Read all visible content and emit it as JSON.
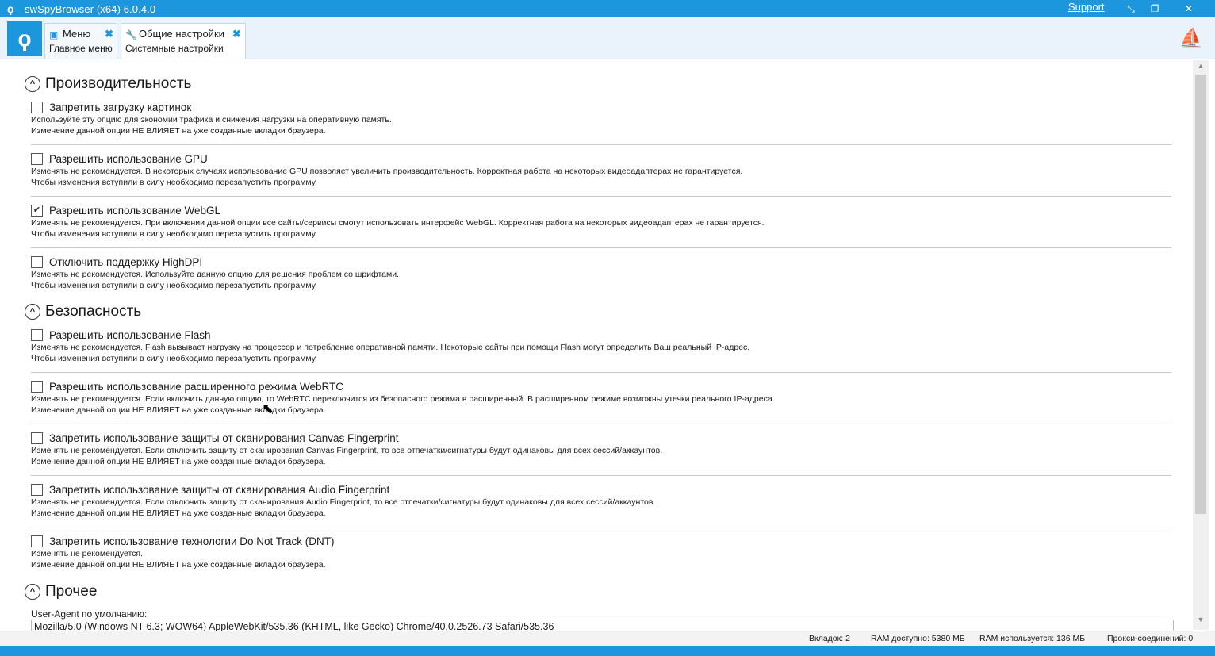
{
  "window": {
    "title": "swSpyBrowser (x64) 6.0.4.0",
    "support_link": "Support",
    "icons": [
      "app-logo-icon",
      "restore-icon",
      "maximize-icon",
      "close-icon"
    ]
  },
  "tabs": [
    {
      "title": "Меню",
      "subtitle": "Главное меню",
      "icon": "menu-icon",
      "active": false
    },
    {
      "title": "Общие настройки",
      "subtitle": "Системные настройки",
      "icon": "wrench-icon",
      "active": true
    }
  ],
  "sections": {
    "performance": {
      "title": "Производительность",
      "options": [
        {
          "label": "Запретить загрузку картинок",
          "checked": false,
          "desc1": "Используйте эту опцию для экономии трафика и снижения нагрузки на оперативную память.",
          "desc2": "Изменение данной опции НЕ ВЛИЯЕТ на уже созданные вкладки браузера."
        },
        {
          "label": "Разрешить использование GPU",
          "checked": false,
          "desc1": "Изменять не рекомендуется. В некоторых случаях использование GPU позволяет увеличить производительность. Корректная работа на некоторых видеоадаптерах не гарантируется.",
          "desc2": "Чтобы изменения вступили в силу необходимо перезапустить программу."
        },
        {
          "label": "Разрешить использование WebGL",
          "checked": true,
          "desc1": "Изменять не рекомендуется. При включении данной опции все сайты/сервисы смогут использовать интерфейс WebGL. Корректная работа на некоторых видеоадаптерах не гарантируется.",
          "desc2": "Чтобы изменения вступили в силу необходимо перезапустить программу."
        },
        {
          "label": "Отключить поддержку HighDPI",
          "checked": false,
          "desc1": "Изменять не рекомендуется. Используйте данную опцию для решения проблем со шрифтами.",
          "desc2": "Чтобы изменения вступили в силу необходимо перезапустить программу."
        }
      ]
    },
    "security": {
      "title": "Безопасность",
      "options": [
        {
          "label": "Разрешить использование Flash",
          "checked": false,
          "desc1": "Изменять не рекомендуется. Flash вызывает нагрузку на процессор и потребление оперативной памяти. Некоторые сайты при помощи Flash могут определить Ваш реальный IP-адрес.",
          "desc2": "Чтобы изменения вступили в силу необходимо перезапустить программу."
        },
        {
          "label": "Разрешить использование расширенного режима WebRTC",
          "checked": false,
          "desc1": "Изменять не рекомендуется. Если включить данную опцию, то WebRTC переключится из безопасного режима в расширенный. В расширенном режиме возможны утечки реального IP-адреса.",
          "desc2": "Изменение данной опции НЕ ВЛИЯЕТ на уже созданные вкладки браузера."
        },
        {
          "label": "Запретить использование защиты от сканирования Canvas Fingerprint",
          "checked": false,
          "desc1": "Изменять не рекомендуется. Если отключить защиту от сканирования Canvas Fingerprint, то все отпечатки/сигнатуры будут одинаковы для всех сессий/аккаунтов.",
          "desc2": "Изменение данной опции НЕ ВЛИЯЕТ на уже созданные вкладки браузера."
        },
        {
          "label": "Запретить использование защиты от сканирования Audio Fingerprint",
          "checked": false,
          "desc1": "Изменять не рекомендуется. Если отключить защиту от сканирования Audio Fingerprint, то все отпечатки/сигнатуры будут одинаковы для всех сессий/аккаунтов.",
          "desc2": "Изменение данной опции НЕ ВЛИЯЕТ на уже созданные вкладки браузера."
        },
        {
          "label": "Запретить использование технологии Do Not Track (DNT)",
          "checked": false,
          "desc1": "Изменять не рекомендуется.",
          "desc2": "Изменение данной опции НЕ ВЛИЯЕТ на уже созданные вкладки браузера."
        }
      ]
    },
    "other": {
      "title": "Прочее",
      "ua_label": "User-Agent по умолчанию:",
      "ua_value": "Mozilla/5.0 (Windows NT 6.3; WOW64) AppleWebKit/535.36 (KHTML, like Gecko) Chrome/40.0.2526.73 Safari/535.36"
    }
  },
  "status": {
    "tabs": "Вкладок:  2",
    "ram_available": "RAM доступно:  5380 МБ",
    "ram_used": "RAM используется:  136 МБ",
    "proxy_connections": "Прокси-соединений:  0"
  },
  "colors": {
    "accent": "#1c97dd"
  }
}
